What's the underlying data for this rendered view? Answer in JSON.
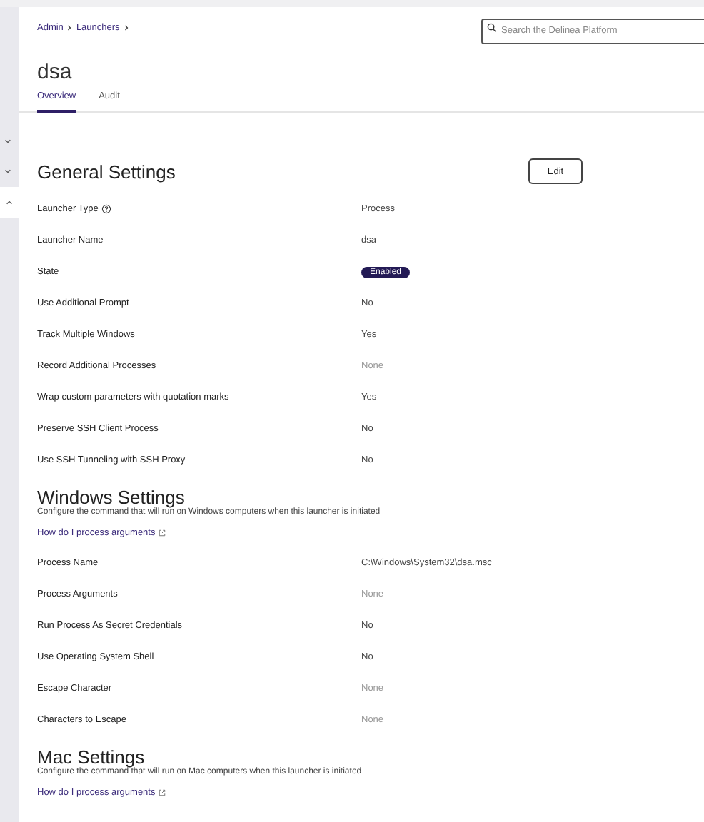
{
  "breadcrumb": [
    "Admin",
    "Launchers"
  ],
  "search": {
    "placeholder": "Search the Delinea Platform"
  },
  "title": "dsa",
  "tabs": [
    {
      "label": "Overview",
      "selected": true
    },
    {
      "label": "Audit",
      "selected": false
    }
  ],
  "sections": [
    {
      "heading": "General Settings",
      "button": "Edit",
      "rows": [
        {
          "label": "Launcher Type",
          "help": true,
          "value": "Process",
          "kind": "text"
        },
        {
          "label": "Launcher Name",
          "value": "dsa",
          "kind": "text"
        },
        {
          "label": "State",
          "value": "Enabled",
          "kind": "badge"
        },
        {
          "label": "Use Additional Prompt",
          "value": "No",
          "kind": "text"
        },
        {
          "label": "Track Multiple Windows",
          "value": "Yes",
          "kind": "text"
        },
        {
          "label": "Record Additional Processes",
          "value": "None",
          "kind": "empty"
        },
        {
          "label": "Wrap custom parameters with quotation marks",
          "value": "Yes",
          "kind": "text"
        },
        {
          "label": "Preserve SSH Client Process",
          "value": "No",
          "kind": "text"
        },
        {
          "label": "Use SSH Tunneling with SSH Proxy",
          "value": "No",
          "kind": "text"
        }
      ]
    },
    {
      "heading": "Windows Settings",
      "description": "Configure the command that will run on Windows computers when this launcher is initiated",
      "link": "How do I process arguments",
      "rows": [
        {
          "label": "Process Name",
          "value": "C:\\Windows\\System32\\dsa.msc",
          "kind": "text"
        },
        {
          "label": "Process Arguments",
          "value": "None",
          "kind": "empty"
        },
        {
          "label": "Run Process As Secret Credentials",
          "value": "No",
          "kind": "text"
        },
        {
          "label": "Use Operating System Shell",
          "value": "No",
          "kind": "text"
        },
        {
          "label": "Escape Character",
          "value": "None",
          "kind": "empty"
        },
        {
          "label": "Characters to Escape",
          "value": "None",
          "kind": "empty"
        }
      ]
    },
    {
      "heading": "Mac Settings",
      "description": "Configure the command that will run on Mac computers when this launcher is initiated",
      "link": "How do I process arguments"
    }
  ]
}
